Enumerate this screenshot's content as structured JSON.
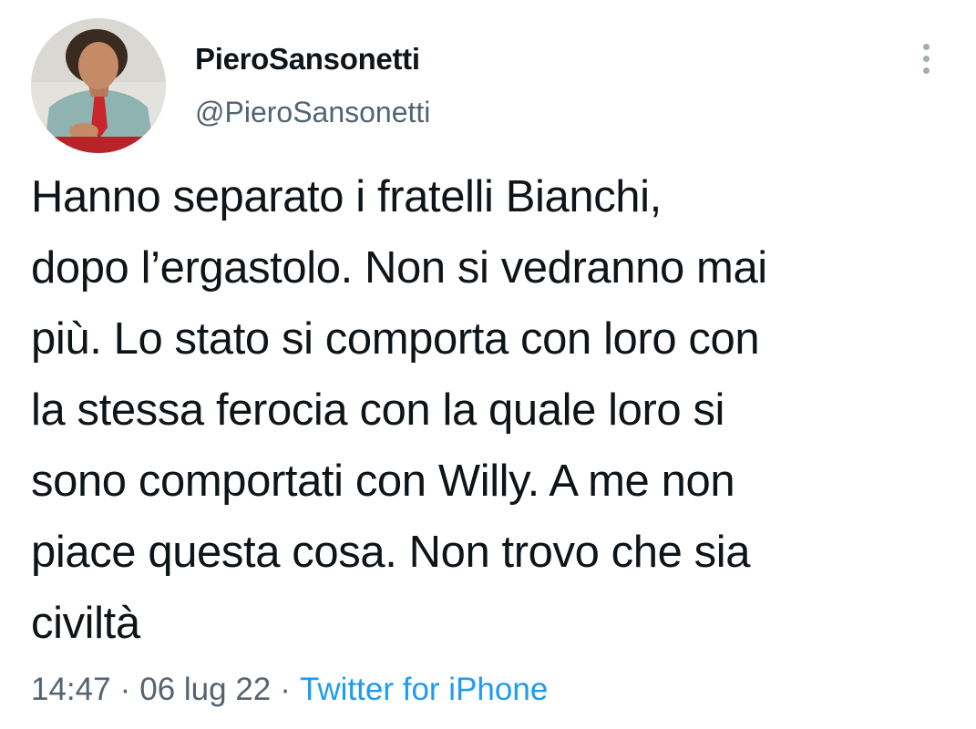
{
  "author": {
    "display_name": "PieroSansonetti",
    "handle": "@PieroSansonetti"
  },
  "tweet": {
    "text": "Hanno separato i fratelli Bianchi,\ndopo l’ergastolo. Non si vedranno mai\npiù. Lo stato si comporta con loro con\nla stessa ferocia con la quale loro si\nsono comportati con Willy. A me non\npiace questa cosa. Non trovo che sia\nciviltà",
    "time": "14:47",
    "date": "06 lug 22",
    "separator": "·",
    "source": "Twitter for iPhone"
  },
  "icons": {
    "more": "more-vertical-icon"
  },
  "colors": {
    "text": "#0f1419",
    "secondary": "#536471",
    "link": "#1d9bf0"
  }
}
